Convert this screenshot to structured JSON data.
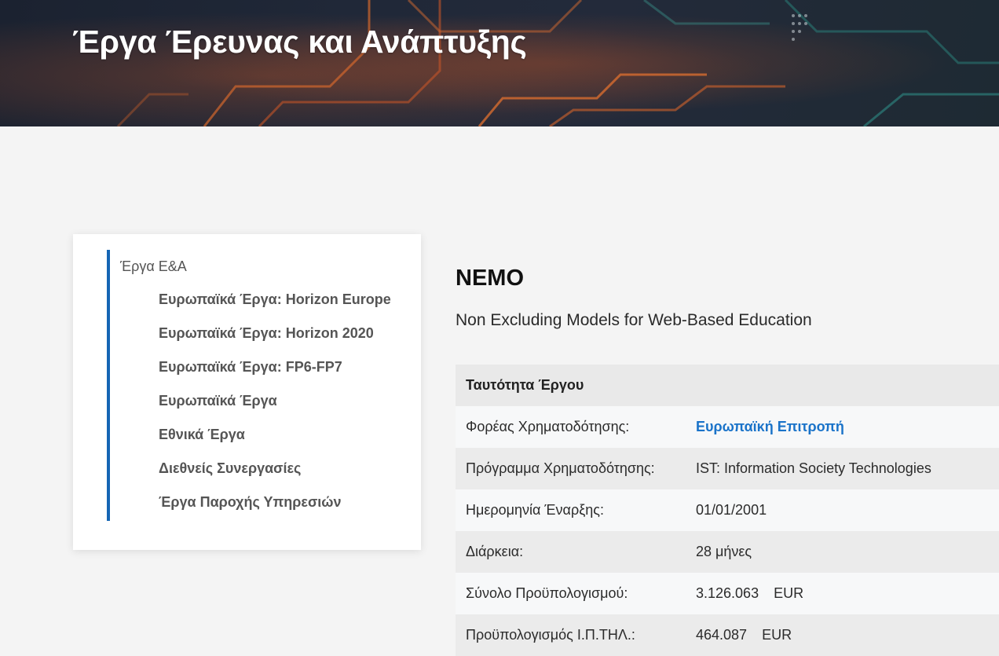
{
  "hero": {
    "title": "Έργα Έρευνας και Ανάπτυξης"
  },
  "sidebar": {
    "root_label": "Έργα Ε&Α",
    "items": [
      {
        "label": "Ευρωπαϊκά Έργα: Horizon Europe"
      },
      {
        "label": "Ευρωπαϊκά Έργα: Horizon 2020"
      },
      {
        "label": "Ευρωπαϊκά Έργα: FP6-FP7"
      },
      {
        "label": "Ευρωπαϊκά Έργα"
      },
      {
        "label": "Εθνικά Έργα"
      },
      {
        "label": "Διεθνείς Συνεργασίες"
      },
      {
        "label": "Έργα Παροχής Υπηρεσιών"
      }
    ]
  },
  "project": {
    "acronym": "NEMO",
    "full_title": "Non Excluding Models for Web-Based Education"
  },
  "info_table": {
    "header": "Ταυτότητα Έργου",
    "rows": [
      {
        "label": "Φορέας Χρηματοδότησης:",
        "value": "Ευρωπαϊκή Επιτροπή"
      },
      {
        "label": "Πρόγραμμα Χρηματοδότησης:",
        "value": "IST: Information Society Technologies"
      },
      {
        "label": "Ημερομηνία Έναρξης:",
        "value": "01/01/2001"
      },
      {
        "label": "Διάρκεια:",
        "value": "28 μήνες"
      },
      {
        "label": "Σύνολο Προϋπολογισμού:",
        "value": "3.126.063",
        "currency": "EUR"
      },
      {
        "label": "Προϋπολογισμός Ι.Π.ΤΗΛ.:",
        "value": "464.087",
        "currency": "EUR"
      }
    ]
  },
  "colors": {
    "accent": "#1565b4",
    "link": "#1a73c9",
    "page_bg": "#f4f4f4"
  }
}
